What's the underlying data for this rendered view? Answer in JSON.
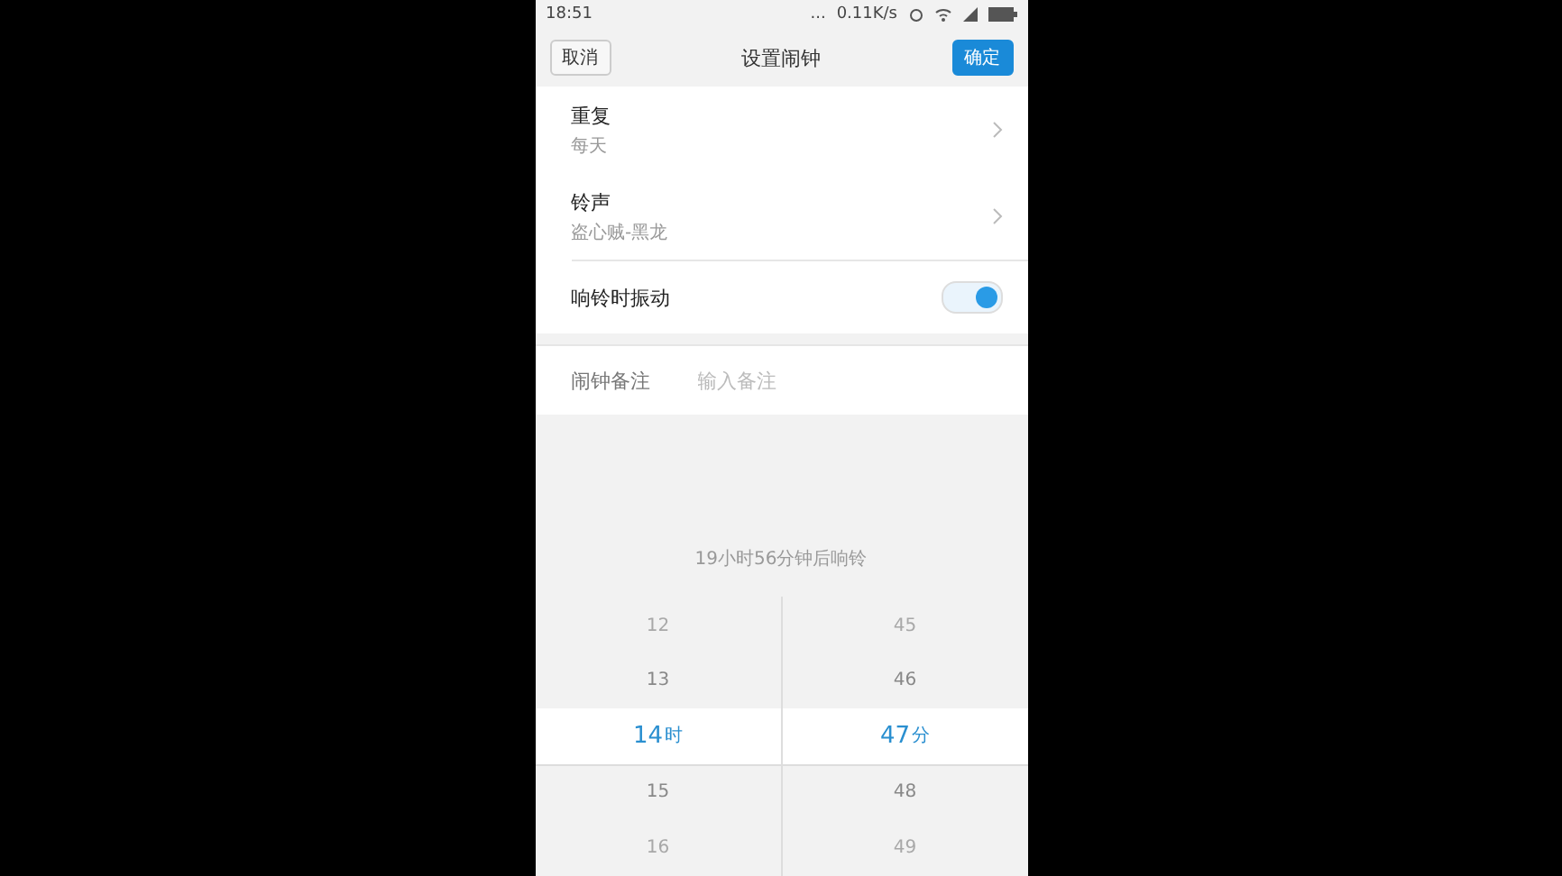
{
  "status_bar": {
    "time": "18:51",
    "dots": "...",
    "net_speed": "0.11K/s"
  },
  "header": {
    "cancel": "取消",
    "title": "设置闹钟",
    "confirm": "确定"
  },
  "settings": [
    {
      "kind": "link",
      "label": "重复",
      "value": "每天"
    },
    {
      "kind": "link",
      "label": "铃声",
      "value": "盗心贼-黑龙"
    },
    {
      "kind": "toggle",
      "label": "响铃时振动",
      "on": true
    }
  ],
  "note": {
    "label": "闹钟备注",
    "placeholder": "输入备注"
  },
  "countdown": "19小时56分钟后响铃",
  "picker": {
    "columns": [
      {
        "unit": "时",
        "items": [
          {
            "value": "12",
            "selected": false
          },
          {
            "value": "13",
            "selected": false
          },
          {
            "value": "14",
            "selected": true
          },
          {
            "value": "15",
            "selected": false
          },
          {
            "value": "16",
            "selected": false
          }
        ]
      },
      {
        "unit": "分",
        "items": [
          {
            "value": "45",
            "selected": false
          },
          {
            "value": "46",
            "selected": false
          },
          {
            "value": "47",
            "selected": true
          },
          {
            "value": "48",
            "selected": false
          },
          {
            "value": "49",
            "selected": false
          }
        ]
      }
    ]
  }
}
